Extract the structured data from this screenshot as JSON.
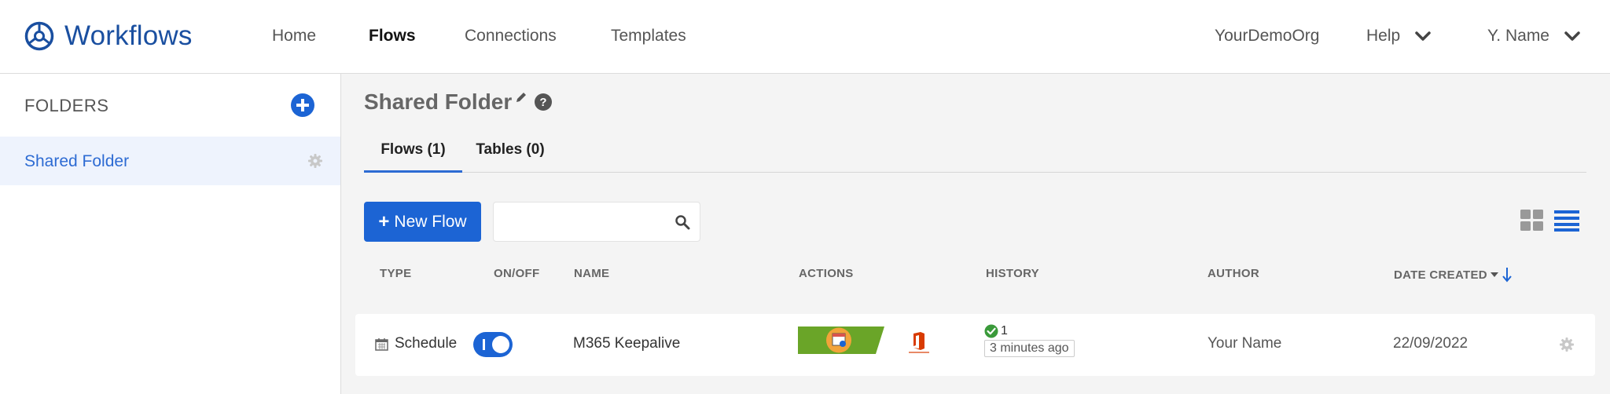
{
  "brand": {
    "name": "Workflows"
  },
  "nav": {
    "items": [
      {
        "label": "Home",
        "active": false
      },
      {
        "label": "Flows",
        "active": true
      },
      {
        "label": "Connections",
        "active": false
      },
      {
        "label": "Templates",
        "active": false
      }
    ],
    "org": "YourDemoOrg",
    "help": "Help",
    "user": "Y. Name"
  },
  "sidebar": {
    "title": "FOLDERS",
    "folders": [
      {
        "label": "Shared Folder",
        "selected": true
      }
    ]
  },
  "main": {
    "folder_title": "Shared Folder",
    "tabs": [
      {
        "label": "Flows (1)",
        "active": true
      },
      {
        "label": "Tables (0)",
        "active": false
      }
    ],
    "new_flow_label": "New Flow",
    "search": {
      "value": "",
      "placeholder": ""
    },
    "columns": {
      "type": "TYPE",
      "onoff": "ON/OFF",
      "name": "NAME",
      "actions": "ACTIONS",
      "history": "HISTORY",
      "author": "AUTHOR",
      "date_created": "DATE CREATED"
    },
    "rows": [
      {
        "type": "Schedule",
        "enabled": true,
        "name": "M365 Keepalive",
        "actions": [
          "schedule-connector-icon",
          "office-365-icon"
        ],
        "history_count": "1",
        "history_time": "3 minutes ago",
        "author": "Your Name",
        "date_created": "22/09/2022"
      }
    ]
  },
  "colors": {
    "brand_blue": "#1a4fa0",
    "primary": "#1c64d4",
    "success": "#3a9a3a",
    "schedule_green": "#6aa528",
    "office_red": "#d83b01"
  }
}
